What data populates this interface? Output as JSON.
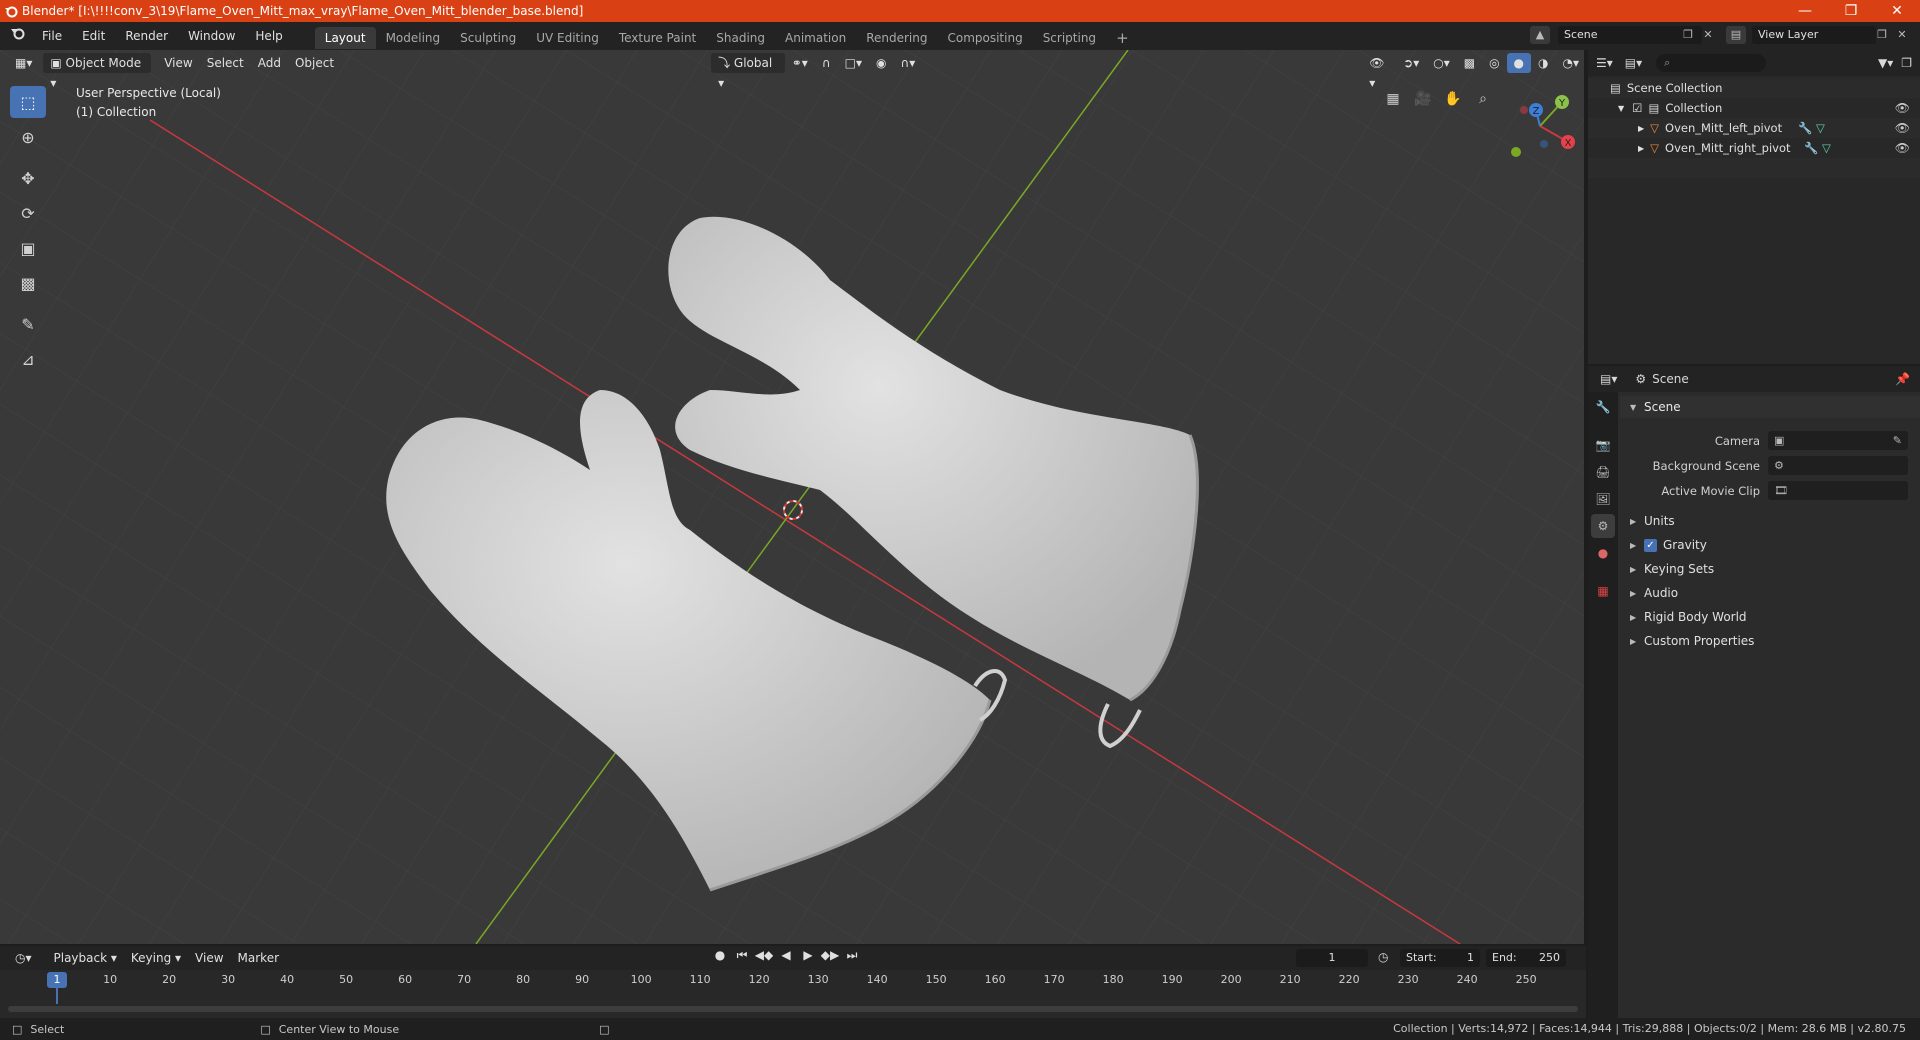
{
  "window": {
    "title": "Blender* [I:\\!!!!conv_3\\19\\Flame_Oven_Mitt_max_vray\\Flame_Oven_Mitt_blender_base.blend]"
  },
  "menu": [
    "File",
    "Edit",
    "Render",
    "Window",
    "Help"
  ],
  "workspaces": [
    {
      "label": "Layout",
      "active": true
    },
    {
      "label": "Modeling",
      "active": false
    },
    {
      "label": "Sculpting",
      "active": false
    },
    {
      "label": "UV Editing",
      "active": false
    },
    {
      "label": "Texture Paint",
      "active": false
    },
    {
      "label": "Shading",
      "active": false
    },
    {
      "label": "Animation",
      "active": false
    },
    {
      "label": "Rendering",
      "active": false
    },
    {
      "label": "Compositing",
      "active": false
    },
    {
      "label": "Scripting",
      "active": false
    }
  ],
  "top_right": {
    "scene": "Scene",
    "view_layer": "View Layer"
  },
  "viewport": {
    "mode": "Object Mode",
    "menus": [
      "View",
      "Select",
      "Add",
      "Object"
    ],
    "transform_orientation": "Global",
    "info_line1": "User Perspective (Local)",
    "info_line2": "(1) Collection",
    "gizmo": {
      "x": "X",
      "y": "Y",
      "z": "Z"
    }
  },
  "outliner": {
    "root": "Scene Collection",
    "collection": "Collection",
    "objects": [
      "Oven_Mitt_left_pivot",
      "Oven_Mitt_right_pivot"
    ]
  },
  "properties": {
    "context": "Scene",
    "panel": "Scene",
    "fields": [
      {
        "label": "Camera"
      },
      {
        "label": "Background Scene"
      },
      {
        "label": "Active Movie Clip"
      }
    ],
    "subpanels": [
      "Units",
      "Gravity",
      "Keying Sets",
      "Audio",
      "Rigid Body World",
      "Custom Properties"
    ]
  },
  "timeline": {
    "menus": [
      "Playback",
      "Keying",
      "View",
      "Marker"
    ],
    "current_frame": "1",
    "start_label": "Start:",
    "start": "1",
    "end_label": "End:",
    "end": "250",
    "ticks": [
      "1",
      "10",
      "20",
      "30",
      "40",
      "50",
      "60",
      "70",
      "80",
      "90",
      "100",
      "110",
      "120",
      "130",
      "140",
      "150",
      "160",
      "170",
      "180",
      "190",
      "200",
      "210",
      "220",
      "230",
      "240",
      "250"
    ]
  },
  "status": {
    "left_action": "Select",
    "middle_action": "Center View to Mouse",
    "info": "Collection | Verts:14,972 | Faces:14,944 | Tris:29,888 | Objects:0/2 | Mem: 28.6 MB | v2.80.75"
  },
  "colors": {
    "accent": "#4772b3",
    "titlebar": "#d94114",
    "x_axis": "#c8383e",
    "y_axis": "#7aa825"
  }
}
